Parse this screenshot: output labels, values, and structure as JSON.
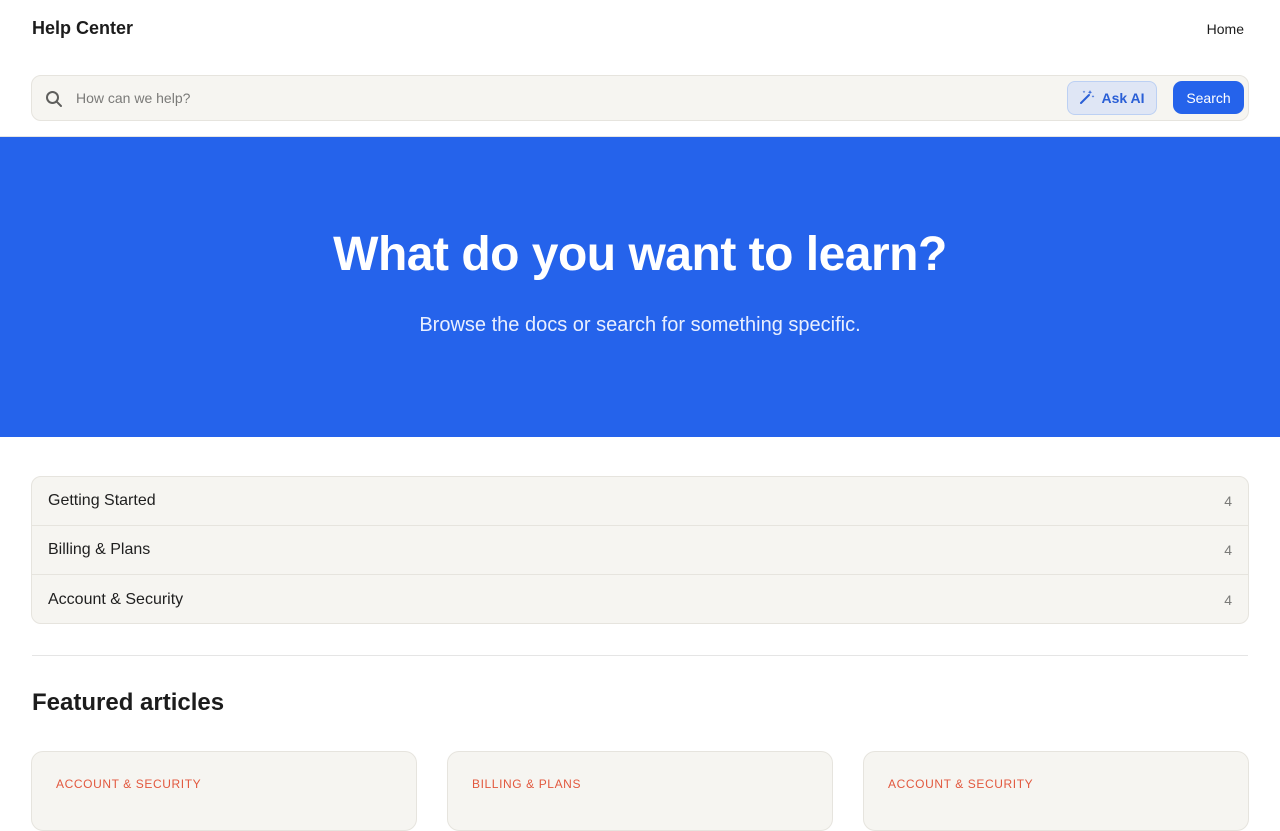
{
  "header": {
    "brand": "Help Center",
    "nav_home": "Home"
  },
  "search": {
    "placeholder": "How can we help?",
    "ask_ai_label": "Ask AI",
    "search_label": "Search"
  },
  "hero": {
    "title": "What do you want to learn?",
    "subtitle": "Browse the docs or search for something specific."
  },
  "categories": [
    {
      "name": "Getting Started",
      "count": "4"
    },
    {
      "name": "Billing & Plans",
      "count": "4"
    },
    {
      "name": "Account & Security",
      "count": "4"
    }
  ],
  "featured": {
    "title": "Featured articles",
    "cards": [
      {
        "category": "ACCOUNT & SECURITY"
      },
      {
        "category": "BILLING & PLANS"
      },
      {
        "category": "ACCOUNT & SECURITY"
      }
    ]
  },
  "colors": {
    "accent": "#2563eb",
    "category_label": "#e2583e",
    "panel_bg": "#f6f5f1"
  },
  "icons": {
    "search": "search-icon",
    "ask_ai": "magic-wand-icon"
  }
}
